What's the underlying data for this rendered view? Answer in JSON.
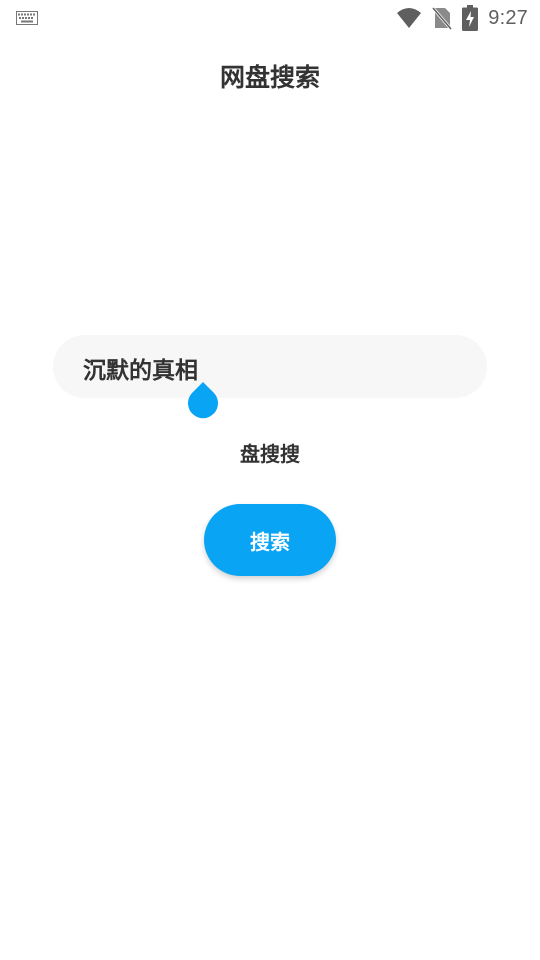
{
  "status_bar": {
    "time": "9:27",
    "icons": [
      "keyboard-icon",
      "wifi-icon",
      "no-sim-icon",
      "battery-charging-icon"
    ],
    "icon_color": "#5f5f5f"
  },
  "header": {
    "title": "网盘搜索"
  },
  "search": {
    "input_value": "沉默的真相",
    "source_label": "盘搜搜",
    "button_label": "搜索"
  },
  "colors": {
    "accent": "#0aa4f5",
    "field_bg": "#f7f7f7",
    "text": "#333333"
  }
}
